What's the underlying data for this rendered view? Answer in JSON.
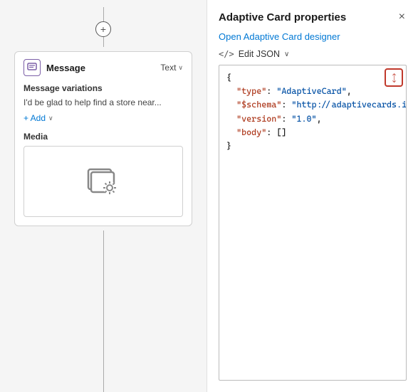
{
  "leftPanel": {
    "addButton": "+",
    "card": {
      "title": "Message",
      "badge": "Text",
      "chevron": "∨",
      "messageVariations": {
        "label": "Message variations",
        "text": "I'd be glad to help find a store near...",
        "addLabel": "+ Add"
      },
      "media": {
        "label": "Media"
      }
    }
  },
  "rightPanel": {
    "title": "Adaptive Card properties",
    "closeLabel": "×",
    "openDesignerLabel": "Open Adaptive Card designer",
    "editJsonLabel": "Edit JSON",
    "editJsonChevron": "∨",
    "codeIcon": "</>",
    "expandIcon": "↗",
    "jsonContent": {
      "line1": "{",
      "line2": "  \"type\": \"AdaptiveCard\",",
      "line3": "  \"$schema\": \"http://adaptivecards.i",
      "line4": "  \"version\": \"1.0\",",
      "line5": "  \"body\": []",
      "line6": "}"
    }
  }
}
